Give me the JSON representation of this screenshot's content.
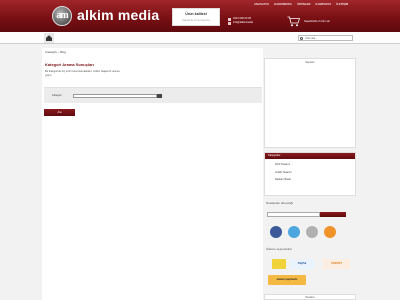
{
  "header": {
    "logo_mark": "am",
    "logo_text": "alkim media",
    "promo": {
      "line1": "Ürün kalitesi",
      "line2": "Garanti ile 12 ay boyunca"
    },
    "contact": {
      "phone": "0212 000 00 00",
      "email": "info@alkimmedia"
    },
    "cart_text": "Sepetinizde 0 ürün var",
    "top_nav": [
      "ANASAYFA",
      "HAKKIMIZDA",
      "ÜRÜNLER",
      "KAMPANYA",
      "İLETİŞİM"
    ]
  },
  "navbar": {
    "search_placeholder": "Ürün ara..."
  },
  "breadcrumb": {
    "home": "Anasayfa",
    "current": "Blog"
  },
  "main": {
    "title": "Kategori Arama Sonuçları",
    "intro": "Bu kategoride hiç ürün bulunmamaktadır. Lütfen başka bir arama yapın.",
    "form_label": "Kategori",
    "submit_label": "Ara"
  },
  "sidebar": {
    "cart_title": "Sepetim",
    "category_title": "Kategoriler",
    "categories": [
      "Web Tasarım",
      "Grafik Tasarım",
      "Reklam Baskı"
    ],
    "newsletter_title": "Newsletter aboneliği",
    "payment_title": "Ödeme seçenekleri",
    "payments": [
      "PayPal",
      "SOFORT",
      "Klarna",
      "amazon payments"
    ],
    "bottom_title": "Hesabım"
  },
  "colors": {
    "brand": "#7a1015",
    "facebook": "#3b5998",
    "twitter": "#4da7de",
    "rss": "#f0932b"
  }
}
